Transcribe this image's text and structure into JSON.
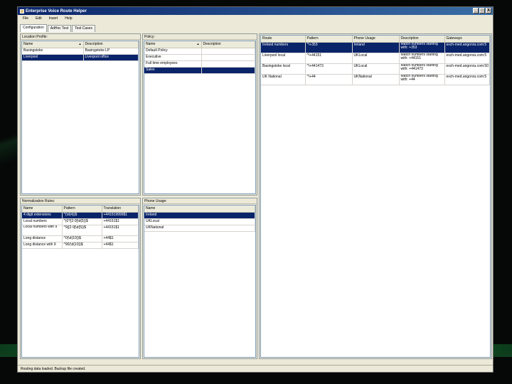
{
  "window": {
    "title": "Enterprise Voice Route Helper",
    "controls": [
      "_",
      "□",
      "X"
    ]
  },
  "menu": [
    "File",
    "Edit",
    "Insert",
    "Help"
  ],
  "tabs": [
    "Configuration",
    "AdHoc Test",
    "Test Cases"
  ],
  "location_profile": {
    "title": "Location Profile:",
    "columns": [
      "Name",
      "Description"
    ],
    "rows": [
      [
        "Basingstoke",
        "Basingstoke LP"
      ],
      [
        "Liverpool",
        "Liverpool office"
      ]
    ],
    "selected": 1
  },
  "policy": {
    "title": "Policy:",
    "columns": [
      "Name",
      "Description"
    ],
    "rows": [
      [
        "Default Policy",
        ""
      ],
      [
        "Executive",
        ""
      ],
      [
        "Full time employees",
        ""
      ],
      [
        "Sales",
        ""
      ]
    ],
    "selected": 3
  },
  "normalization_rules": {
    "title": "Normalization Rules:",
    "columns": [
      "Name",
      "Pattern",
      "Translation"
    ],
    "rows": [
      [
        "4 digit extensions",
        "^(\\d{4})$",
        "+441519999$1"
      ],
      [
        "Local numbers",
        "^(0?[2-9]\\d{5})$",
        "+44151$1"
      ],
      [
        "Local numbers with 9",
        "^9([2-9]\\d{5})$",
        "+44151$1"
      ],
      [
        "Long distance",
        "^0(\\d{10})$",
        "+44$1"
      ],
      [
        "Long distance with 9",
        "^90(\\d{10})$",
        "+44$1"
      ]
    ],
    "selected": 0
  },
  "phone_usage": {
    "title": "Phone Usage:",
    "columns": [
      "Name"
    ],
    "rows": [
      [
        "Ireland"
      ],
      [
        "UKLocal"
      ],
      [
        "UKNational"
      ]
    ],
    "selected": 0
  },
  "routes": {
    "columns": [
      "Route",
      "Pattern",
      "Phone Usage",
      "Description",
      "Gateways"
    ],
    "rows": [
      [
        "Ireland numbers",
        "^\\+353",
        "Ireland",
        "Match numbers starting with: +353",
        "exch-med.angonra.com:5"
      ],
      [
        "Liverpool local",
        "^\\+44151",
        "UKLocal",
        "Match numbers starting with: +44151",
        "exch-med.angonra.com:5"
      ],
      [
        "Basingstoke local",
        "^\\+441473",
        "UKLocal",
        "Match numbers starting with: +441473",
        "exch-med.angonra.com:50"
      ],
      [
        "UK National",
        "^\\+44",
        "UKNational",
        "Match numbers starting with: +44",
        "exch-med.angonra.com:5"
      ]
    ],
    "selected": 0
  },
  "status": "Routing data loaded. Backup file created."
}
